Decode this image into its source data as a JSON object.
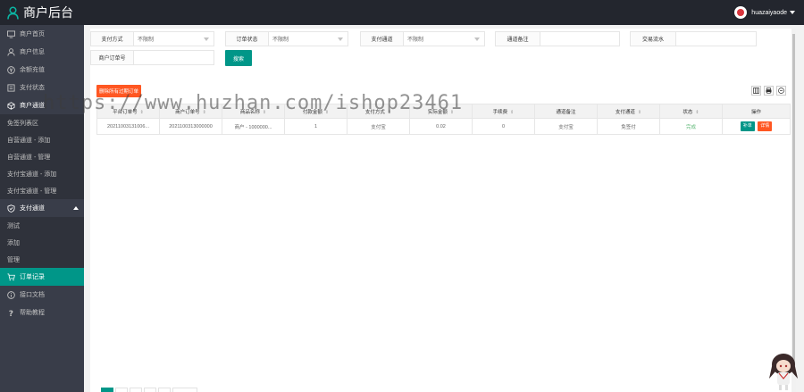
{
  "app": {
    "title": "商户后台"
  },
  "user": {
    "name": "huazaiyaode"
  },
  "sidebar": {
    "items": [
      {
        "label": "商户首页"
      },
      {
        "label": "商户信息"
      },
      {
        "label": "余额充值"
      },
      {
        "label": "支付状态"
      },
      {
        "label": "商户通道"
      },
      {
        "label": "免签列表区",
        "sub": true
      },
      {
        "label": "自营通道 - 添加",
        "sub": true
      },
      {
        "label": "自营通道 - 管理",
        "sub": true
      },
      {
        "label": "支付宝通道 - 添加",
        "sub": true
      },
      {
        "label": "支付宝通道 - 管理",
        "sub": true
      },
      {
        "label": "支付通道"
      },
      {
        "label": "测试",
        "sub": true
      },
      {
        "label": "添加",
        "sub": true
      },
      {
        "label": "管理",
        "sub": true
      },
      {
        "label": "订单记录"
      },
      {
        "label": "接口文档"
      },
      {
        "label": "帮助教程"
      }
    ]
  },
  "filters": {
    "pay_method_label": "支付方式",
    "pay_method_value": "不限制",
    "order_status_label": "订单状态",
    "order_status_value": "不限制",
    "pay_channel_label": "支付通道",
    "pay_channel_value": "不限制",
    "channel_note_label": "通道备注",
    "trade_no_label": "交易流水",
    "merchant_order_label": "商户订单号",
    "search_label": "搜索"
  },
  "toolbar": {
    "delete_label": "删除所有过期订单"
  },
  "table": {
    "columns": [
      "平台订单号",
      "商户订单号",
      "商品名称",
      "付款金额",
      "支付方式",
      "实际金额",
      "手续费",
      "通道备注",
      "支付通道",
      "状态",
      "操作"
    ],
    "rows": [
      {
        "cells": [
          "20211003131006...",
          "2021100313000000",
          "商户 - 1000000...",
          "1",
          "支付宝",
          "0.02",
          "0",
          "支付宝",
          "免签付",
          "完成"
        ],
        "actions": [
          "补单",
          "详情"
        ]
      }
    ]
  },
  "watermark": "https://www.huzhan.com/ishop23461",
  "colors": {
    "accent": "#009688",
    "danger": "#ff5722",
    "sidebar": "#393d49",
    "header": "#23262e",
    "success": "#5fb878"
  }
}
